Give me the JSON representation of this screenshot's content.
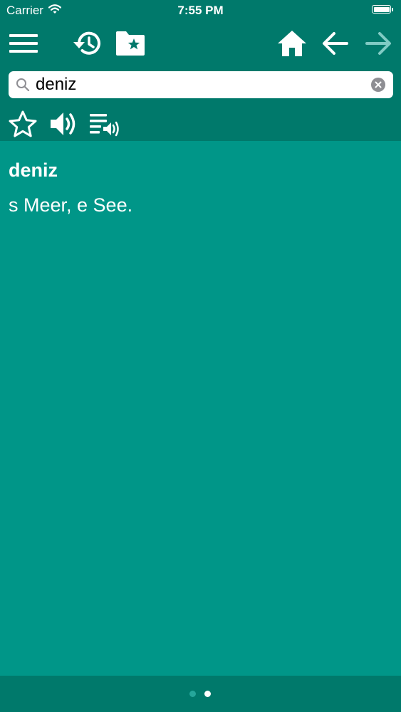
{
  "status_bar": {
    "carrier": "Carrier",
    "time": "7:55 PM",
    "icons": [
      "wifi-icon",
      "battery-icon"
    ]
  },
  "toolbar": {
    "icons": [
      "menu-icon",
      "history-icon",
      "bookmark-folder-icon",
      "home-icon",
      "back-arrow-icon",
      "forward-arrow-icon"
    ],
    "forward_enabled": false
  },
  "search": {
    "value": "deniz",
    "placeholder": ""
  },
  "actions": {
    "icons": [
      "star-icon",
      "speaker-icon",
      "speak-list-icon"
    ]
  },
  "entry": {
    "word": "deniz",
    "definition": "s Meer, e See."
  },
  "pager": {
    "pages": 2,
    "current": 2
  },
  "colors": {
    "header": "#00796b",
    "background": "#009688",
    "text": "#ffffff",
    "disabled_icon": "#80cbc4"
  }
}
